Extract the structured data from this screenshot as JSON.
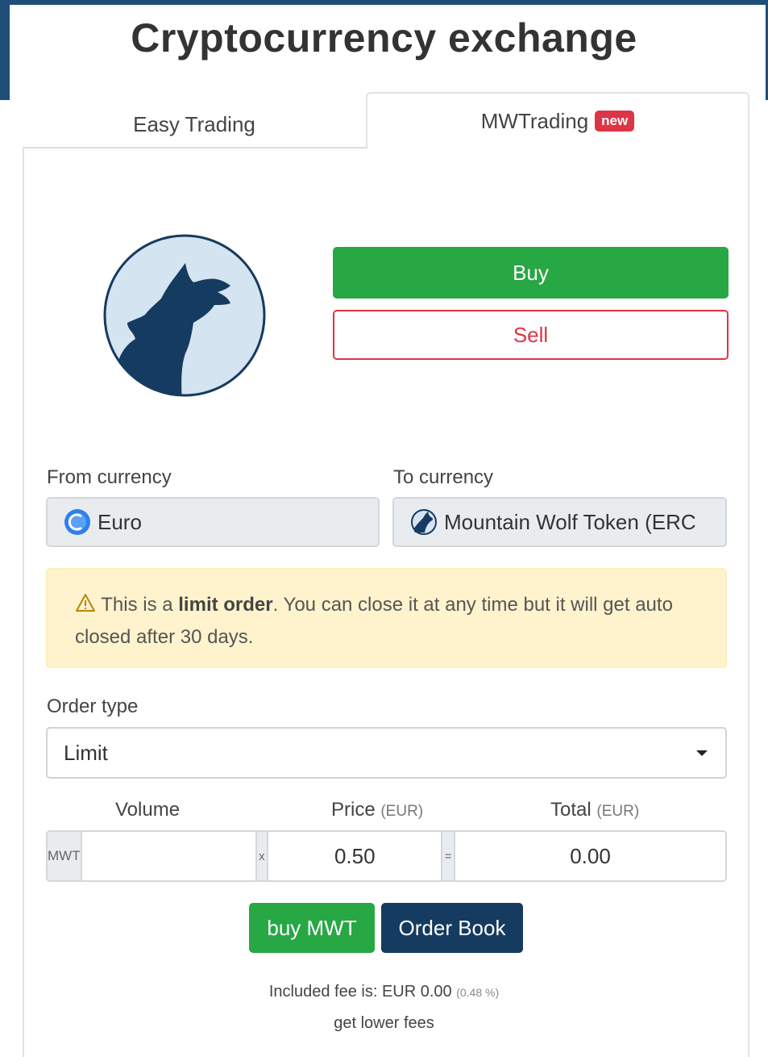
{
  "page": {
    "title": "Cryptocurrency exchange"
  },
  "tabs": [
    {
      "label": "Easy Trading",
      "active": false
    },
    {
      "label": "MWTrading",
      "badge": "new",
      "active": true
    }
  ],
  "coin_logo": {
    "icon": "wolf-icon",
    "color": "#163b60",
    "background": "#d5e4f1"
  },
  "actions": {
    "buy_label": "Buy",
    "sell_label": "Sell"
  },
  "currencies": {
    "from_label": "From currency",
    "from_value": "Euro",
    "from_icon": "euro-icon",
    "to_label": "To currency",
    "to_value": "Mountain Wolf Token (ERC",
    "to_icon": "wolf-token-icon"
  },
  "alert": {
    "icon": "warning-icon",
    "prefix": "This is a ",
    "bold": "limit order",
    "suffix": ". You can close it at any time but it will get auto closed after 30 days."
  },
  "order_type": {
    "label": "Order type",
    "value": "Limit"
  },
  "order_form": {
    "volume_label": "Volume",
    "price_label": "Price",
    "price_unit": "(EUR)",
    "total_label": "Total",
    "total_unit": "(EUR)",
    "volume_addon": "MWT",
    "multiply_addon": "x",
    "equals_addon": "=",
    "volume_value": "",
    "price_value": "0.50",
    "total_value": "0.00"
  },
  "buttons": {
    "buy_mwt": "buy MWT",
    "order_book": "Order Book"
  },
  "fees": {
    "text": "Included fee is: EUR 0.00",
    "percent": "(0.48 %)",
    "link": "get lower fees"
  },
  "colors": {
    "brand_navy": "#1f4e79",
    "buy_green": "#28a745",
    "sell_red": "#dc3545",
    "order_book_navy": "#163b60",
    "alert_bg": "#fff3cd"
  }
}
